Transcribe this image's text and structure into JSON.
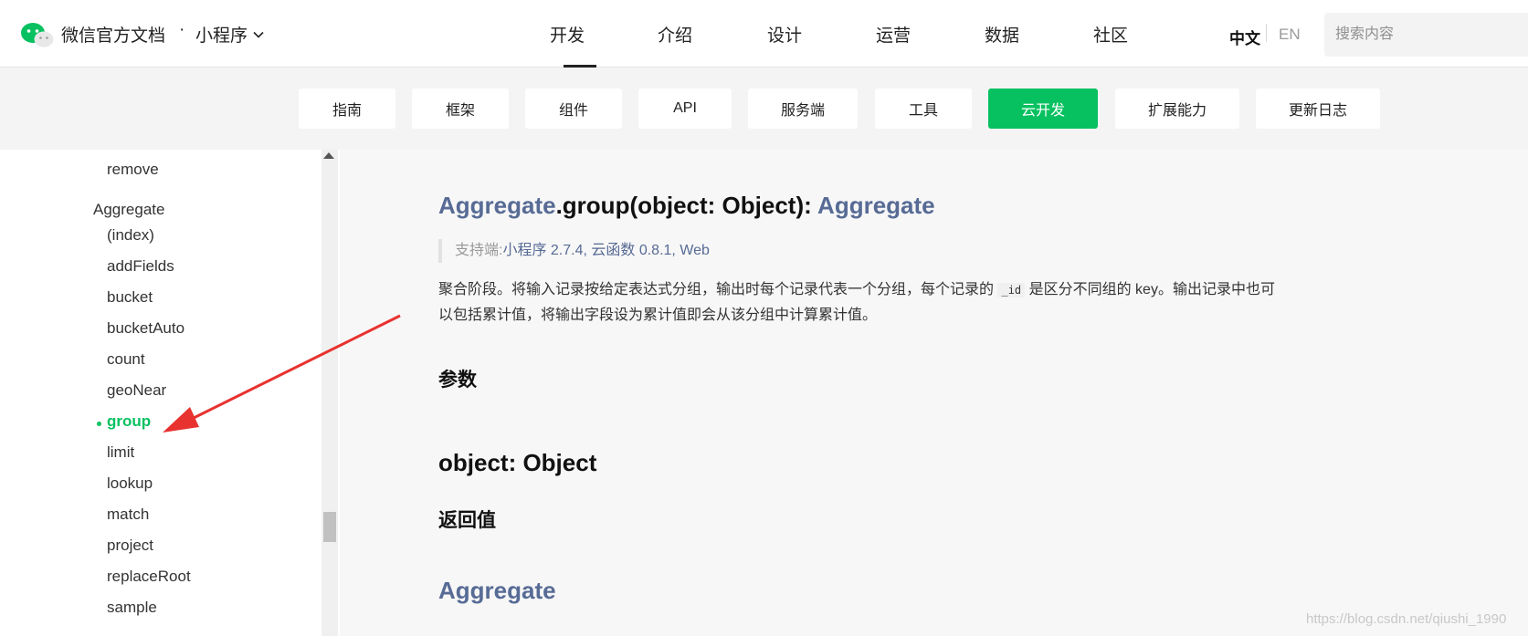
{
  "header": {
    "brand": "微信官方文档",
    "separator": "·",
    "product": "小程序",
    "nav": [
      "开发",
      "介绍",
      "设计",
      "运营",
      "数据",
      "社区"
    ],
    "active_nav": "开发",
    "lang_zh": "中文",
    "lang_en": "EN",
    "search_placeholder": "搜索内容"
  },
  "subnav": {
    "tabs": [
      "指南",
      "框架",
      "组件",
      "API",
      "服务端",
      "工具",
      "云开发",
      "扩展能力",
      "更新日志"
    ],
    "active_tab": "云开发"
  },
  "sidebar": {
    "items": [
      {
        "label": "remove"
      },
      {
        "label": "Aggregate"
      },
      {
        "label": "(index)"
      },
      {
        "label": "addFields"
      },
      {
        "label": "bucket"
      },
      {
        "label": "bucketAuto"
      },
      {
        "label": "count"
      },
      {
        "label": "geoNear"
      },
      {
        "label": "group"
      },
      {
        "label": "limit"
      },
      {
        "label": "lookup"
      },
      {
        "label": "match"
      },
      {
        "label": "project"
      },
      {
        "label": "replaceRoot"
      },
      {
        "label": "sample"
      }
    ],
    "active": "group"
  },
  "main": {
    "title_type": "Aggregate",
    "title_method": ".group(object: Object): ",
    "title_return": "Aggregate",
    "support_label": "支持端:",
    "support_values": "小程序 2.7.4, 云函数 0.8.1, Web",
    "desc_part1": "聚合阶段。将输入记录按给定表达式分组，输出时每个记录代表一个分组，每个记录的",
    "desc_code": "_id",
    "desc_part2": "是区分不同组的 key。输出记录中也可以包括累计值，将输出字段设为累计值即会从该分组中计算累计值。",
    "params_heading": "参数",
    "param_sig": "object: Object",
    "return_heading": "返回值",
    "return_type": "Aggregate"
  },
  "watermark": "https://blog.csdn.net/qiushi_1990",
  "colors": {
    "accent": "#07c160",
    "link": "#576b95"
  }
}
